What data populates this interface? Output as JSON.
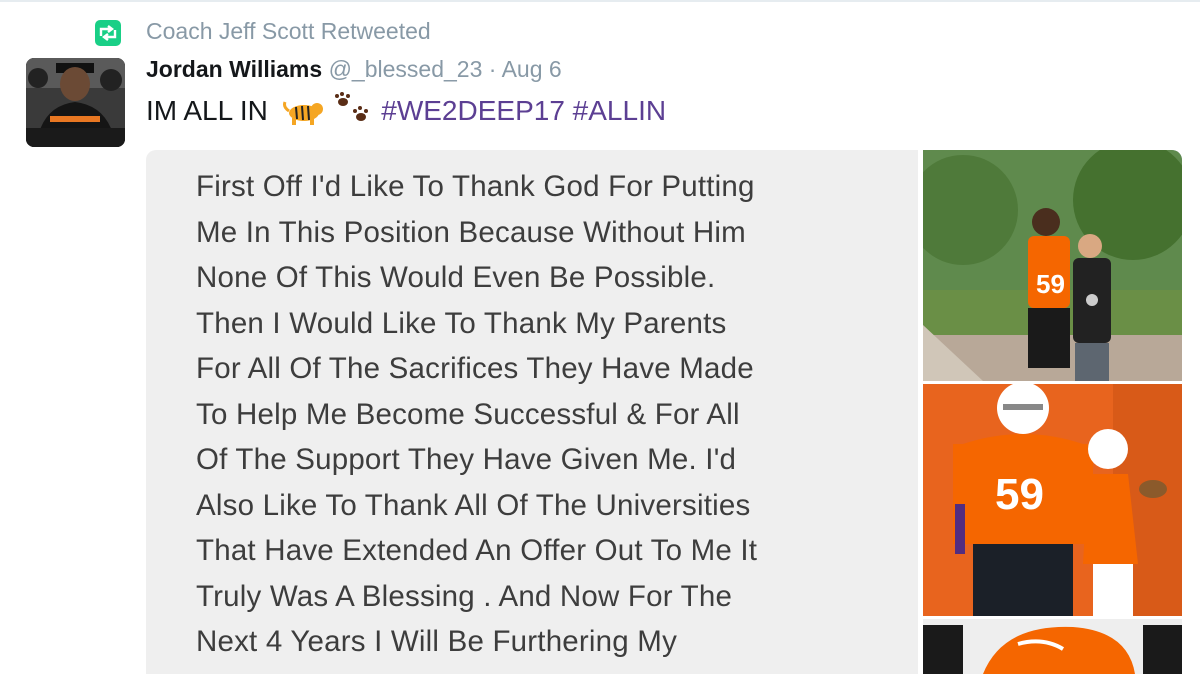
{
  "retweet": {
    "label": "Coach Jeff Scott Retweeted",
    "icon": "retweet-icon",
    "icon_color": "#19cf86"
  },
  "tweet": {
    "author_name": "Jordan Williams",
    "handle": "@_blessed_23",
    "separator": "·",
    "date": "Aug 6",
    "text_prefix": "IM ALL IN",
    "emojis": [
      "tiger-emoji",
      "paw-prints-emoji"
    ],
    "hashtags": [
      "#WE2DEEP17",
      "#ALLIN"
    ]
  },
  "note": {
    "lines": [
      "First Off I'd Like To Thank God For Putting",
      "Me In This Position Because Without Him",
      "None Of This Would Even Be Possible.",
      "Then I Would Like To Thank My Parents",
      "For All Of The Sacrifices They Have Made",
      "To Help Me Become Successful & For All",
      "Of The Support They Have Given Me. I'd",
      "Also Like To Thank All Of The Universities",
      "That Have Extended An Offer Out To Me It",
      "Truly Was A Blessing . And Now For The",
      "Next 4 Years I Will Be Furthering My"
    ]
  },
  "photos": {
    "jersey_number": "59"
  },
  "colors": {
    "muted": "#8899a6",
    "hashtag": "#5c3f93",
    "clemson_orange": "#f56600",
    "clemson_purple": "#522d80"
  }
}
